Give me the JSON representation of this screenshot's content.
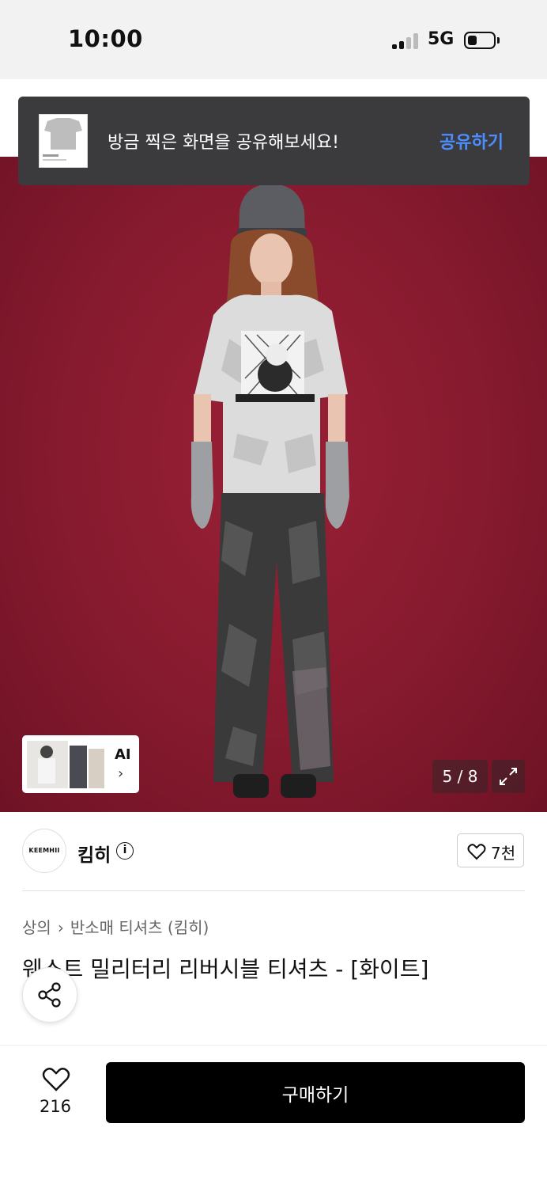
{
  "status_bar": {
    "time": "10:00",
    "network": "5G"
  },
  "toast": {
    "message": "방금 찍은 화면을 공유해보세요!",
    "action": "공유하기"
  },
  "gallery": {
    "ai_label": "AI",
    "counter": "5 / 8",
    "background_color": "#861a2e"
  },
  "brand": {
    "logo_text": "KEEMHII",
    "name": "킴히",
    "like_count": "7천"
  },
  "breadcrumb": [
    "상의",
    "반소매 티셔츠 (킴히)"
  ],
  "product": {
    "title": "웨스트 밀리터리 리버시블 티셔츠 - [화이트]"
  },
  "bottom_bar": {
    "wish_count": "216",
    "buy_label": "구매하기"
  },
  "icons": [
    "info-icon",
    "heart-icon",
    "share-icon",
    "expand-icon",
    "chevron-right-icon"
  ]
}
